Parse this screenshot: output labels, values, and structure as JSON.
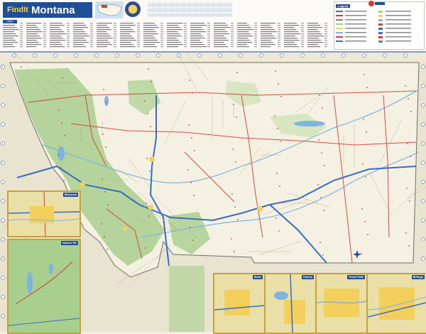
{
  "header": {
    "brand": "FindIt",
    "state_name": "Montana",
    "facts_title": "MONTANA",
    "capital_label": "Capital: Helena",
    "index_heading": "Cities"
  },
  "legend": {
    "title": "Legend"
  },
  "insets": {
    "missoula": "Missoula",
    "glacier": "Glacier NP",
    "butte": "Butte",
    "helena": "Helena",
    "great_falls": "Great Falls",
    "billings": "Billings"
  },
  "colors": {
    "header_blue": "#1f4f96",
    "brand_yellow": "#ffd22e",
    "map_land": "#f4f0e2",
    "forest": "#a8cf8e",
    "water": "#7fb3e0",
    "interstate": "#3a6cc4",
    "highway": "#d63a2f",
    "neighbor": "#e9e4cf",
    "urban": "#f3cf5b"
  },
  "icons": {
    "compass": "compass-rose-icon",
    "us_locator": "us-locator-map-icon",
    "state_seal": "state-seal-icon",
    "publisher_logo": "publisher-logo-icon"
  }
}
